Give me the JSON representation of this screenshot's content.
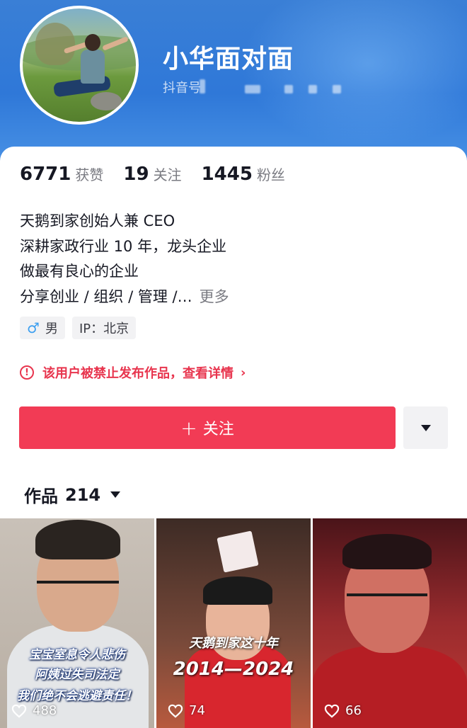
{
  "profile": {
    "nickname": "小华面对面",
    "douyin_id_label": "抖音号",
    "avatar_icon": "avatar-photo"
  },
  "stats": [
    {
      "value": "6771",
      "label": "获赞"
    },
    {
      "value": "19",
      "label": "关注"
    },
    {
      "value": "1445",
      "label": "粉丝"
    }
  ],
  "bio": {
    "lines": [
      "天鹅到家创始人兼 CEO",
      "深耕家政行业 10 年，龙头企业",
      "做最有良心的企业",
      "分享创业 / 组织 / 管理 /…"
    ],
    "more_label": "更多"
  },
  "tags": {
    "gender_icon": "♂",
    "gender": "男",
    "ip": "IP：北京"
  },
  "notice": {
    "icon": "!",
    "text": "该用户被禁止发布作品，查看详情"
  },
  "actions": {
    "follow_label": "关注",
    "follow_plus": "+"
  },
  "works": {
    "label": "作品",
    "count": "214",
    "items": [
      {
        "likes": "488",
        "caption": [
          "宝宝室息令人悲伤",
          "阿姨过失司法定",
          "我们绝不会逃避责任！"
        ]
      },
      {
        "likes": "74",
        "caption": [
          "天鹅到家这十年",
          "2014—2024"
        ]
      },
      {
        "likes": "66",
        "caption": []
      }
    ]
  },
  "colors": {
    "header_blue": "#2f78d8",
    "accent_red": "#f23b55",
    "notice_red": "#e8354e"
  }
}
